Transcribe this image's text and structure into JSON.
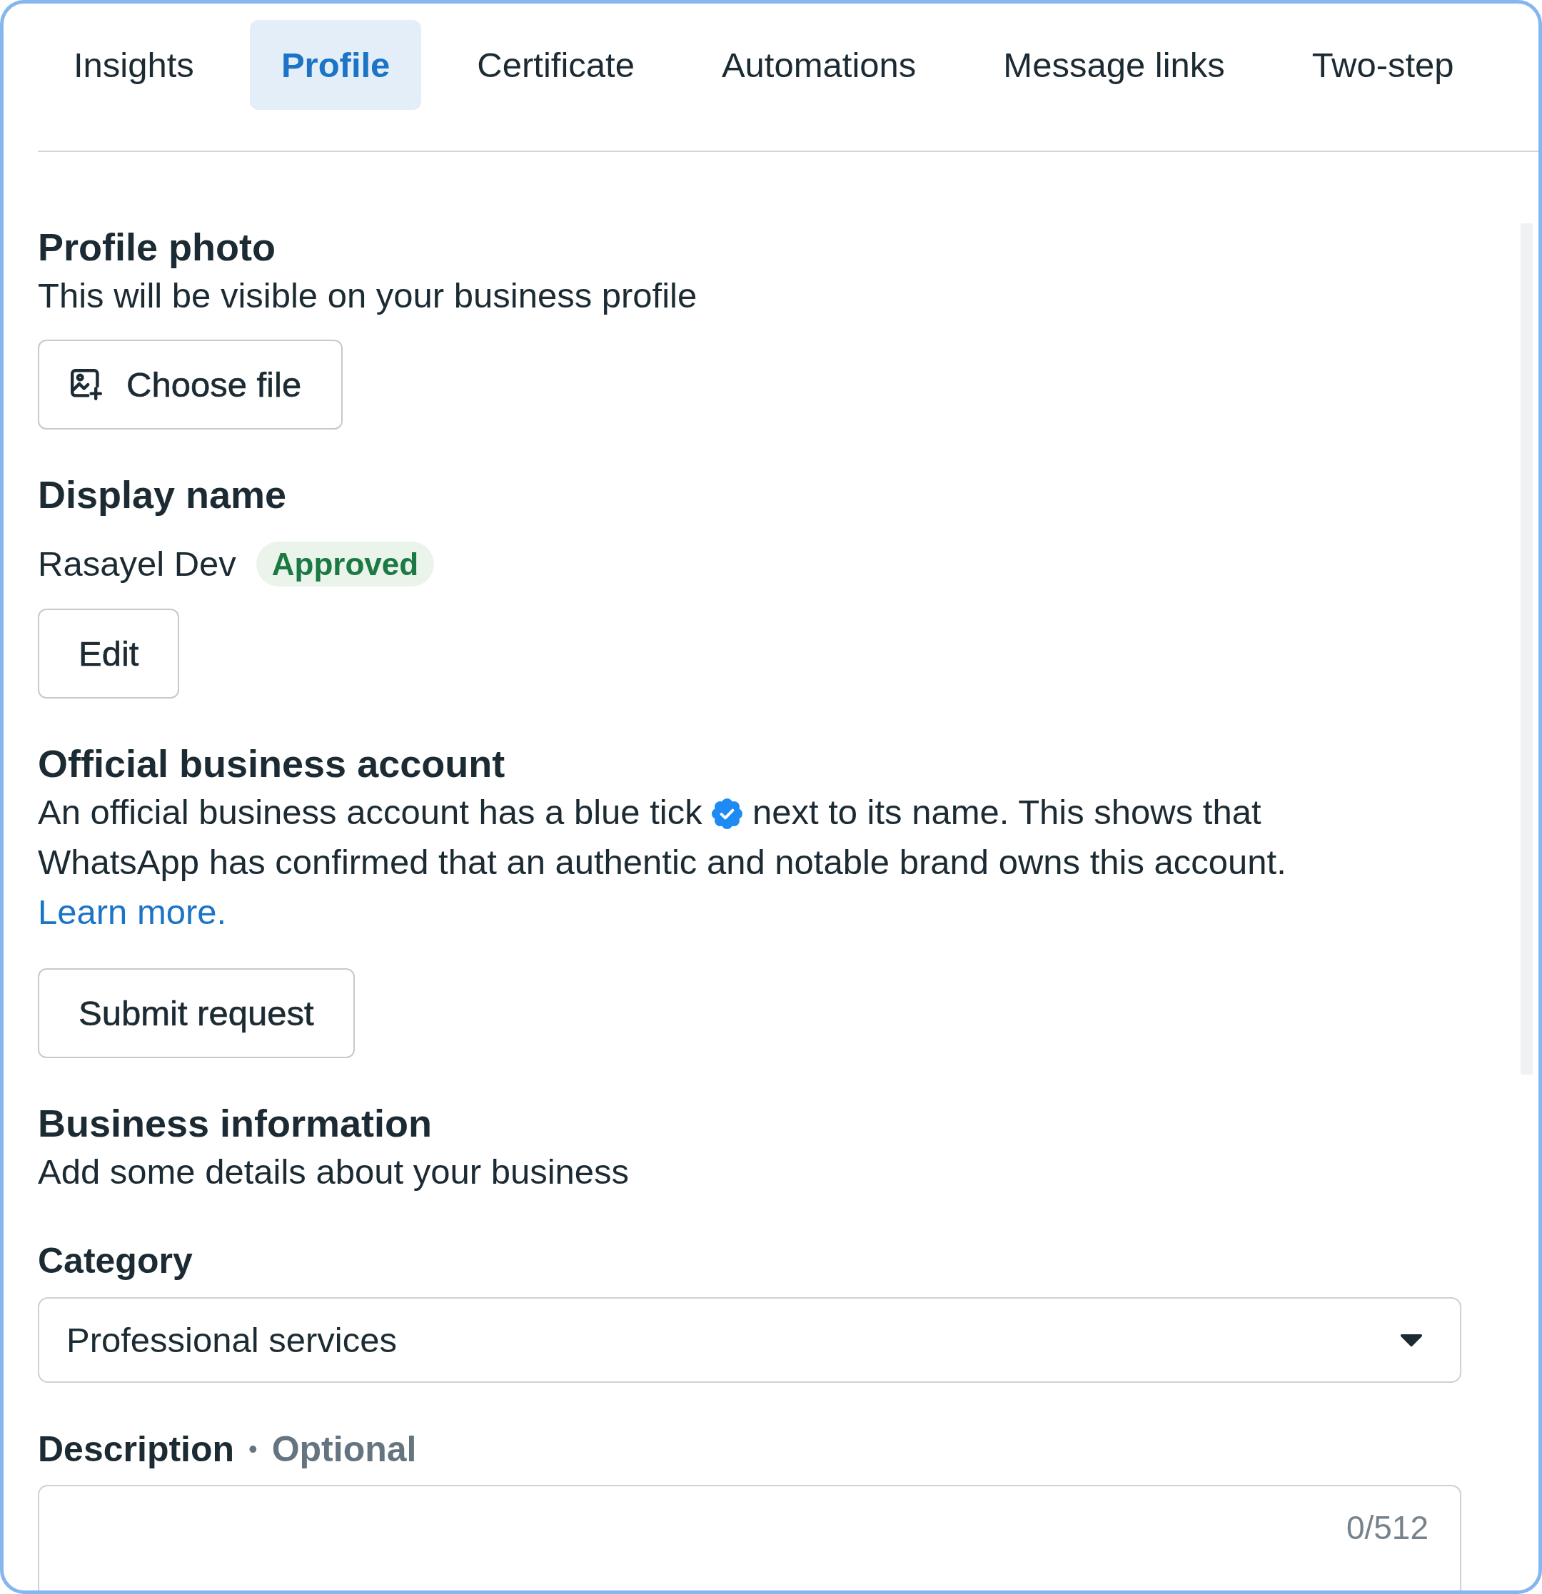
{
  "tabs": [
    {
      "label": "Insights",
      "selected": false
    },
    {
      "label": "Profile",
      "selected": true
    },
    {
      "label": "Certificate",
      "selected": false
    },
    {
      "label": "Automations",
      "selected": false
    },
    {
      "label": "Message links",
      "selected": false
    },
    {
      "label": "Two-step",
      "selected": false
    }
  ],
  "sections": [
    {
      "kind": "photo",
      "title": "Profile photo",
      "subtitle": "This will be visible on your business profile",
      "button": "Choose file"
    },
    {
      "kind": "display_name",
      "title": "Display name",
      "name": "Rasayel Dev",
      "status": "Approved",
      "button": "Edit"
    },
    {
      "kind": "official_account",
      "title": "Official business account",
      "text_before_icon": "An official business account has a blue tick",
      "text_after_icon": "next to its name. This shows that WhatsApp has confirmed that an authentic and notable brand owns this account.",
      "link": "Learn more.",
      "button": "Submit request"
    },
    {
      "kind": "business_info",
      "title": "Business information",
      "subtitle": "Add some details about your business",
      "fields": [
        {
          "kind": "select",
          "label": "Category",
          "value": "Professional services"
        },
        {
          "kind": "textarea",
          "label": "Description",
          "separator": "•",
          "note": "Optional",
          "counter": "0/512"
        }
      ]
    }
  ]
}
